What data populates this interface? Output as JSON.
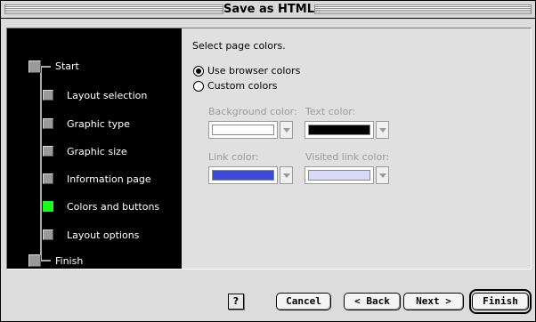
{
  "window": {
    "title": "Save as HTML"
  },
  "steps": [
    {
      "label": "Start",
      "state": "done"
    },
    {
      "label": "Layout selection",
      "state": "done"
    },
    {
      "label": "Graphic type",
      "state": "done"
    },
    {
      "label": "Graphic size",
      "state": "done"
    },
    {
      "label": "Information page",
      "state": "done"
    },
    {
      "label": "Colors and buttons",
      "state": "current"
    },
    {
      "label": "Layout options",
      "state": "pending"
    },
    {
      "label": "Finish",
      "state": "pending"
    }
  ],
  "content": {
    "prompt": "Select page colors.",
    "options": [
      {
        "label": "Use browser colors",
        "selected": true
      },
      {
        "label": "Custom colors",
        "selected": false
      }
    ],
    "colors": {
      "background": {
        "label": "Background color:",
        "value": "#ffffff"
      },
      "text": {
        "label": "Text color:",
        "value": "#000000"
      },
      "link": {
        "label": "Link color:",
        "value": "#3b4bd6"
      },
      "visited": {
        "label": "Visited link color:",
        "value": "#d8d8f8"
      }
    }
  },
  "buttons": {
    "help": "?",
    "cancel": "Cancel",
    "back": "< Back",
    "next": "Next >",
    "finish": "Finish"
  },
  "accent": {
    "active_step": "#19ff19"
  }
}
